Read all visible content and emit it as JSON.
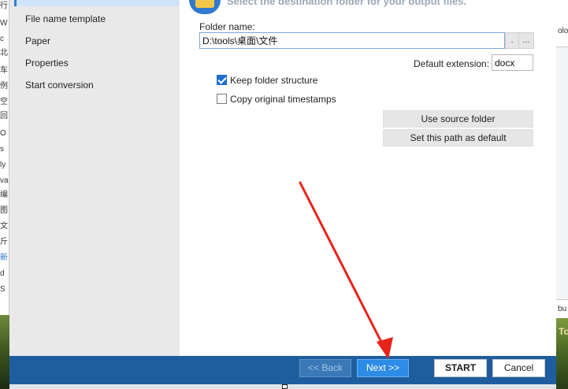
{
  "background_left_glyphs": [
    "行",
    "W",
    "c",
    "北",
    "车",
    "例",
    "空",
    "回",
    "O",
    "s",
    "ly",
    "va",
    "编",
    "图",
    "文",
    "斤",
    "新",
    "d",
    "S"
  ],
  "background_right": {
    "top_text": "olo",
    "mid_text": "bu",
    "bottom_text": "Tc"
  },
  "nav": {
    "items": [
      {
        "label": "File name template"
      },
      {
        "label": "Paper"
      },
      {
        "label": "Properties"
      },
      {
        "label": "Start conversion"
      }
    ]
  },
  "header": {
    "title": "Select the destination folder for your output files."
  },
  "folder": {
    "label": "Folder name:",
    "value": "D:\\tools\\桌面\\文件",
    "browse_dot_label": ".",
    "browse_label": "..."
  },
  "extension": {
    "label": "Default extension:",
    "value": "docx"
  },
  "options": {
    "keep_structure": {
      "label": "Keep folder structure",
      "checked": true
    },
    "copy_timestamps": {
      "label": "Copy original timestamps",
      "checked": false
    }
  },
  "actions": {
    "use_source": "Use source folder",
    "set_default": "Set this path as default"
  },
  "footer": {
    "back": "<< Back",
    "next": "Next >>",
    "start": "START",
    "cancel": "Cancel"
  },
  "colors": {
    "accent": "#1f5e9e",
    "next_button": "#2c8ce6",
    "annotation_arrow": "#e8231a"
  }
}
